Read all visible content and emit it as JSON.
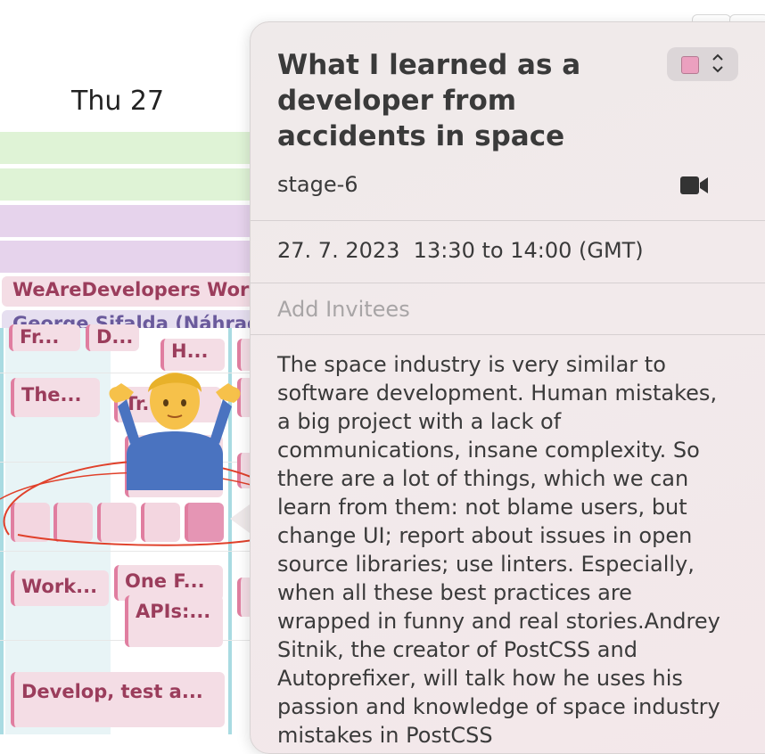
{
  "calendar": {
    "day_header": "Thu 27",
    "all_day_events": [
      {
        "label": "WeAreDevelopers World Congress",
        "type": "pink"
      },
      {
        "label": "George Sifalda (Náhrada)",
        "type": "purple"
      }
    ],
    "events": [
      {
        "label": "Fr..."
      },
      {
        "label": "D..."
      },
      {
        "label": "H..."
      },
      {
        "label": "The..."
      },
      {
        "label": "Tr..."
      },
      {
        "label": "Work..."
      },
      {
        "label": "One F..."
      },
      {
        "label": "APIs:..."
      },
      {
        "label": "Develop, test a..."
      }
    ]
  },
  "popover": {
    "title": "What I learned as a developer from accidents in space",
    "location": "stage-6",
    "date": "27. 7. 2023",
    "time": "13:30 to 14:00 (GMT)",
    "invitees_placeholder": "Add Invitees",
    "description": "The space industry is very similar to software development. Human mistakes, a big project with a lack of communications, insane complexity. So there are a lot of things, which we can learn from them: not blame users, but change UI; report about issues in open source libraries; use linters. Especially, when all these best practices are wrapped in funny and real stories.Andrey Sitnik, the creator of PostCSS and Autoprefixer, will talk how he uses his passion and knowledge of space industry mistakes in PostCSS",
    "calendar_color": "#eba0bf",
    "video_icon": "video-camera-icon"
  },
  "colors": {
    "event_pink": "#f4dde5",
    "event_accent": "#e07ea0",
    "allday_green": "#dff3d6",
    "allday_purple": "#e6d3ec"
  }
}
